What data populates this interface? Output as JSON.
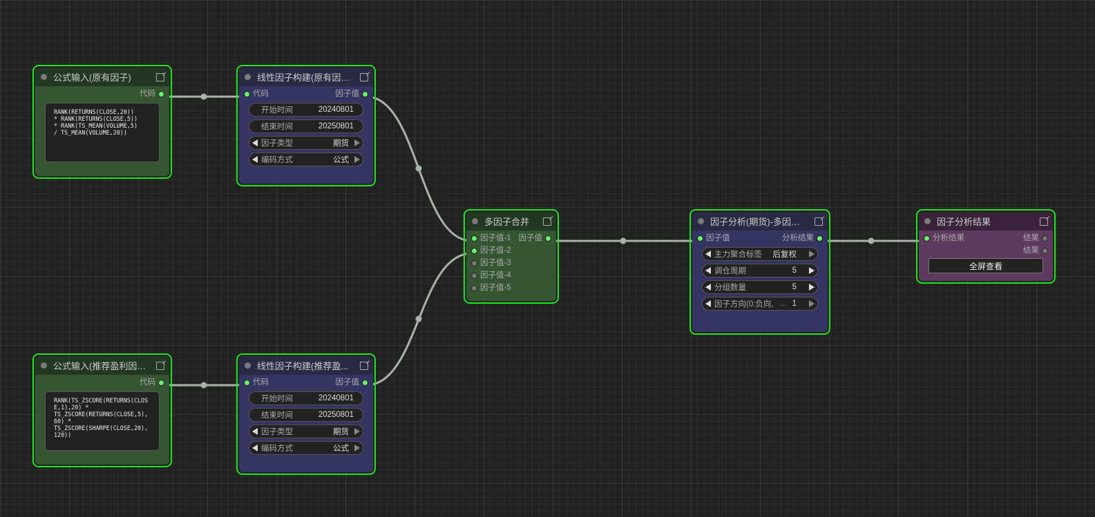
{
  "nodes": {
    "formula1": {
      "title": "公式输入(原有因子)",
      "out": "代码",
      "text": "RANK(RETURNS(CLOSE,20))\n* RANK(RETURNS(CLOSE,5))\n* RANK(TS_MEAN(VOLUME,5)\n/ TS_MEAN(VOLUME,20))"
    },
    "linear1": {
      "title": "线性因子构建(原有因子)",
      "in": "代码",
      "out": "因子值",
      "start_label": "开始时间",
      "start_value": "20240801",
      "end_label": "结束时间",
      "end_value": "20250801",
      "type_label": "因子类型",
      "type_value": "期货",
      "enc_label": "编码方式",
      "enc_value": "公式"
    },
    "formula2": {
      "title": "公式输入(推荐盈利因子)",
      "out": "代码",
      "text": "RANK(TS_ZSCORE(RETURNS(CLOSE,1),20) *\nTS_ZSCORE(RETURNS(CLOSE,5),60) *\nTS_ZSCORE(SHARPE(CLOSE,20),120))"
    },
    "linear2": {
      "title": "线性因子构建(推荐盈...",
      "in": "代码",
      "out": "因子值",
      "start_label": "开始时间",
      "start_value": "20240801",
      "end_label": "结束时间",
      "end_value": "20250801",
      "type_label": "因子类型",
      "type_value": "期货",
      "enc_label": "编码方式",
      "enc_value": "公式"
    },
    "merge": {
      "title": "多因子合并",
      "in1": "因子值-1",
      "in2": "因子值-2",
      "in3": "因子值-3",
      "in4": "因子值-4",
      "in5": "因子值-5",
      "out": "因子值"
    },
    "analysis": {
      "title": "因子分析(期货)-多因子...",
      "in": "因子值",
      "out": "分析结果",
      "w1_label": "主力聚合标签",
      "w1_value": "后复权",
      "w2_label": "调仓周期",
      "w2_value": "5",
      "w3_label": "分组数量",
      "w3_value": "5",
      "w4_label": "因子方向(0:负向,",
      "w4_ellipsis": "...",
      "w4_value": "1"
    },
    "result": {
      "title": "因子分析结果",
      "in": "分析结果",
      "out1": "结果",
      "out2": "结果",
      "button": "全屏查看"
    }
  },
  "colors": {
    "selection": "#1ee51e",
    "link": "#a8b4a8",
    "pin_active": "#6bf26b",
    "green_node": "#355533",
    "blue_node": "#353564",
    "purple_node": "#5e3a5e"
  }
}
